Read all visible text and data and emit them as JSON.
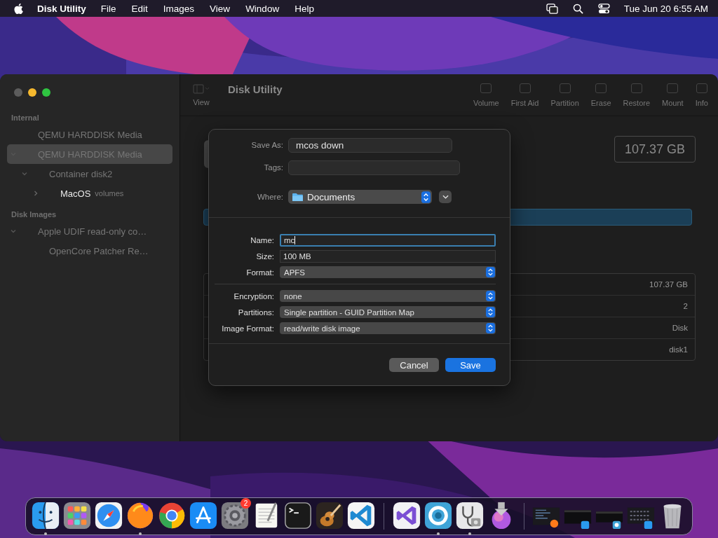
{
  "menu_bar": {
    "app_name": "Disk Utility",
    "items": [
      "File",
      "Edit",
      "Images",
      "View",
      "Window",
      "Help"
    ],
    "clock": "Tue Jun 20  6:55 AM"
  },
  "window": {
    "title": "Disk Utility",
    "view_label": "View",
    "toolbar": [
      {
        "label": "Volume"
      },
      {
        "label": "First Aid"
      },
      {
        "label": "Partition"
      },
      {
        "label": "Erase"
      },
      {
        "label": "Restore"
      },
      {
        "label": "Mount"
      },
      {
        "label": "Info"
      }
    ],
    "sidebar": [
      {
        "heading": "Internal",
        "items": [
          {
            "label": "QEMU HARDDISK Media",
            "selected": false,
            "dimmed": true
          },
          {
            "label": "QEMU HARDDISK Media",
            "selected": true,
            "dimmed": true,
            "expanded": true,
            "children": [
              {
                "label": "Container disk2",
                "selected": false,
                "dimmed": true,
                "expanded": true,
                "children": [
                  {
                    "label": "MacOS",
                    "sublabel": "volumes",
                    "selected": false,
                    "dimmed": false,
                    "expanded": false
                  }
                ]
              }
            ]
          }
        ]
      },
      {
        "heading": "Disk Images",
        "items": [
          {
            "label": "Apple UDIF read-only co…",
            "selected": false,
            "dimmed": true,
            "expanded": true,
            "children": [
              {
                "label": "OpenCore Patcher Re…",
                "selected": false,
                "dimmed": true
              }
            ]
          }
        ]
      }
    ],
    "capacity": "107.37 GB",
    "info_values": [
      "107.37 GB",
      "2",
      "Disk",
      "disk1"
    ]
  },
  "dialog": {
    "save_as": {
      "label": "Save As:",
      "value": "mcos down"
    },
    "tags": {
      "label": "Tags:"
    },
    "where": {
      "label": "Where:",
      "value": "Documents"
    },
    "groups": [
      [
        {
          "kind": "text",
          "label": "Name:",
          "value": "mc",
          "focused": true
        },
        {
          "kind": "text",
          "label": "Size:",
          "value": "100 MB",
          "focused": false
        },
        {
          "kind": "popup",
          "label": "Format:",
          "value": "APFS"
        }
      ],
      [
        {
          "kind": "popup",
          "label": "Encryption:",
          "value": "none"
        },
        {
          "kind": "popup",
          "label": "Partitions:",
          "value": "Single partition - GUID Partition Map"
        },
        {
          "kind": "popup",
          "label": "Image Format:",
          "value": "read/write disk image"
        }
      ]
    ],
    "buttons": [
      {
        "label": "Cancel",
        "default": false
      },
      {
        "label": "Save",
        "default": true
      }
    ]
  },
  "dock": {
    "groups": [
      [
        {
          "running": true
        },
        {
          "running": false
        },
        {
          "running": false
        },
        {
          "running": true
        },
        {
          "running": false
        },
        {
          "running": false
        },
        {
          "running": false,
          "badge": "2"
        },
        {
          "running": false
        },
        {
          "running": false
        },
        {
          "running": false
        },
        {
          "running": false
        }
      ],
      [
        {
          "running": false
        },
        {
          "running": true
        },
        {
          "running": true
        },
        {
          "running": false
        }
      ]
    ]
  }
}
